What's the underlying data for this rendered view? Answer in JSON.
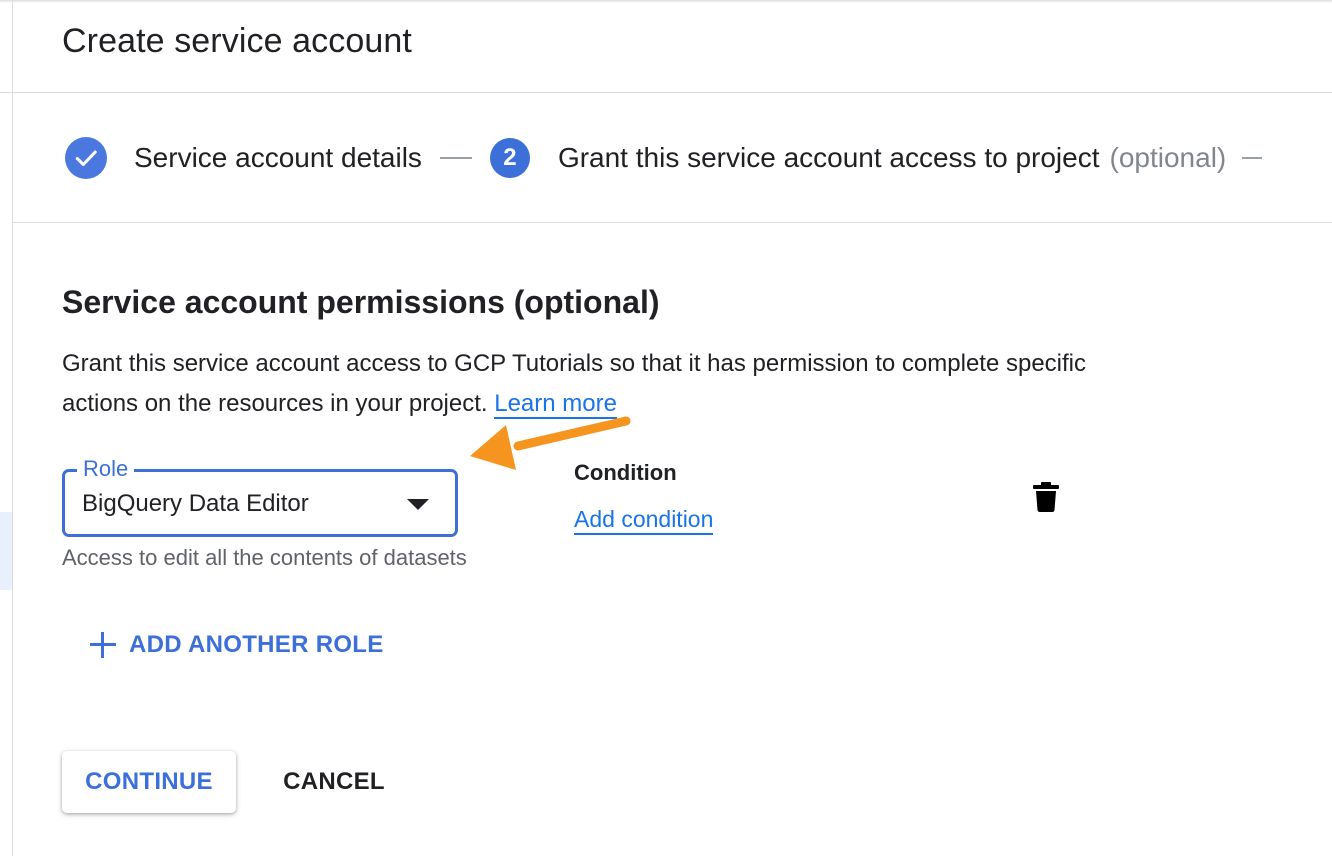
{
  "page": {
    "title": "Create service account"
  },
  "stepper": {
    "steps": [
      {
        "label": "Service account details",
        "state": "completed",
        "icon": "check-icon"
      },
      {
        "number": "2",
        "label": "Grant this service account access to project",
        "suffix": "(optional)",
        "state": "active"
      }
    ]
  },
  "permissions": {
    "heading": "Service account permissions (optional)",
    "description": "Grant this service account access to GCP Tutorials so that it has permission to complete specific actions on the resources in your project.",
    "learn_more": "Learn more"
  },
  "role": {
    "label": "Role",
    "value": "BigQuery Data Editor",
    "helper": "Access to edit all the contents of datasets"
  },
  "condition": {
    "label": "Condition",
    "add_label": "Add condition"
  },
  "actions": {
    "add_another_role": "ADD ANOTHER ROLE",
    "continue": "CONTINUE",
    "cancel": "CANCEL"
  },
  "icons": {
    "delete": "trash-icon",
    "dropdown": "caret-down-icon",
    "add": "plus-icon",
    "annotation": "orange-arrow-icon"
  },
  "colors": {
    "accent": "#3c6fd8",
    "link": "#1a73e8",
    "annotation": "#f5951f",
    "divider": "#dadce0"
  }
}
